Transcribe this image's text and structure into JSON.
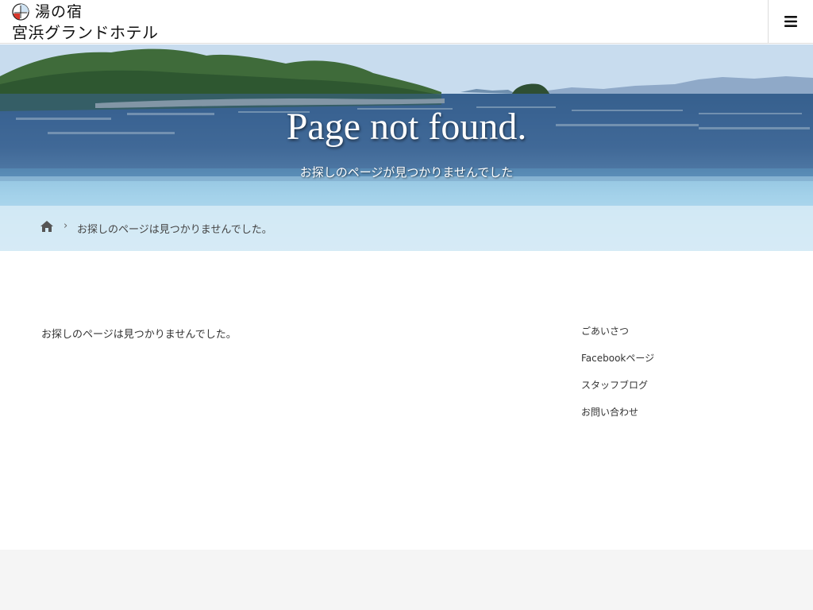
{
  "header": {
    "logo_line1": "湯の宿",
    "logo_line2": "宮浜グランドホテル",
    "menu_icon": "hamburger-menu-icon"
  },
  "hero": {
    "title": "Page not found.",
    "subtitle": "お探しのページが見つかりませんでした"
  },
  "breadcrumb": {
    "home_icon": "home-icon",
    "separator": "›",
    "current": "お探しのページは見つかりませんでした。"
  },
  "main": {
    "message": "お探しのページは見つかりませんでした。"
  },
  "sidebar": {
    "links": [
      {
        "label": "ごあいさつ"
      },
      {
        "label": "Facebookページ"
      },
      {
        "label": "スタッフブログ"
      },
      {
        "label": "お問い合わせ"
      }
    ]
  },
  "colors": {
    "header_bg": "#ffffff",
    "footer_bg": "#f5f5f5",
    "text": "#333333"
  }
}
